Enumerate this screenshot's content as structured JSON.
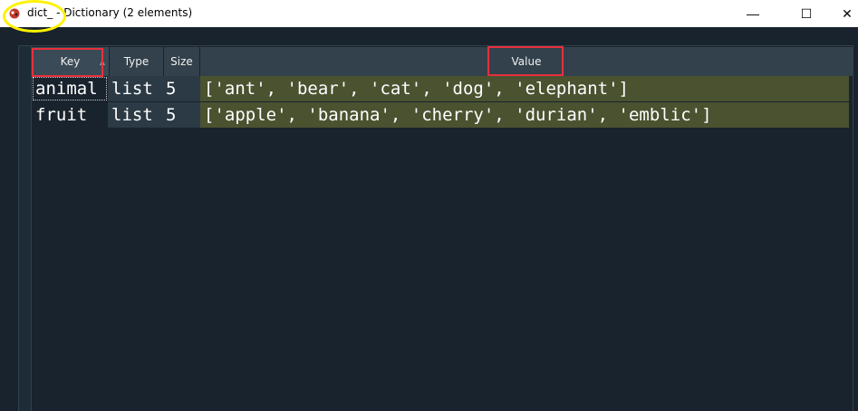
{
  "window": {
    "title": "dict_ - Dictionary (2 elements)",
    "minimize_glyph": "—",
    "maximize_glyph": "☐",
    "close_glyph": "✕"
  },
  "table": {
    "headers": {
      "key": "Key",
      "type": "Type",
      "size": "Size",
      "value": "Value"
    },
    "sort_indicator": "▲",
    "rows": [
      {
        "key": "animal",
        "type": "list",
        "size": "5",
        "value": "['ant', 'bear', 'cat', 'dog', 'elephant']"
      },
      {
        "key": "fruit",
        "type": "list",
        "size": "5",
        "value": "['apple', 'banana', 'cherry', 'durian', 'emblic']"
      }
    ]
  },
  "colors": {
    "annotation_ellipse": "#fff200",
    "annotation_box": "#e8303c",
    "value_highlight": "#4a5230"
  }
}
